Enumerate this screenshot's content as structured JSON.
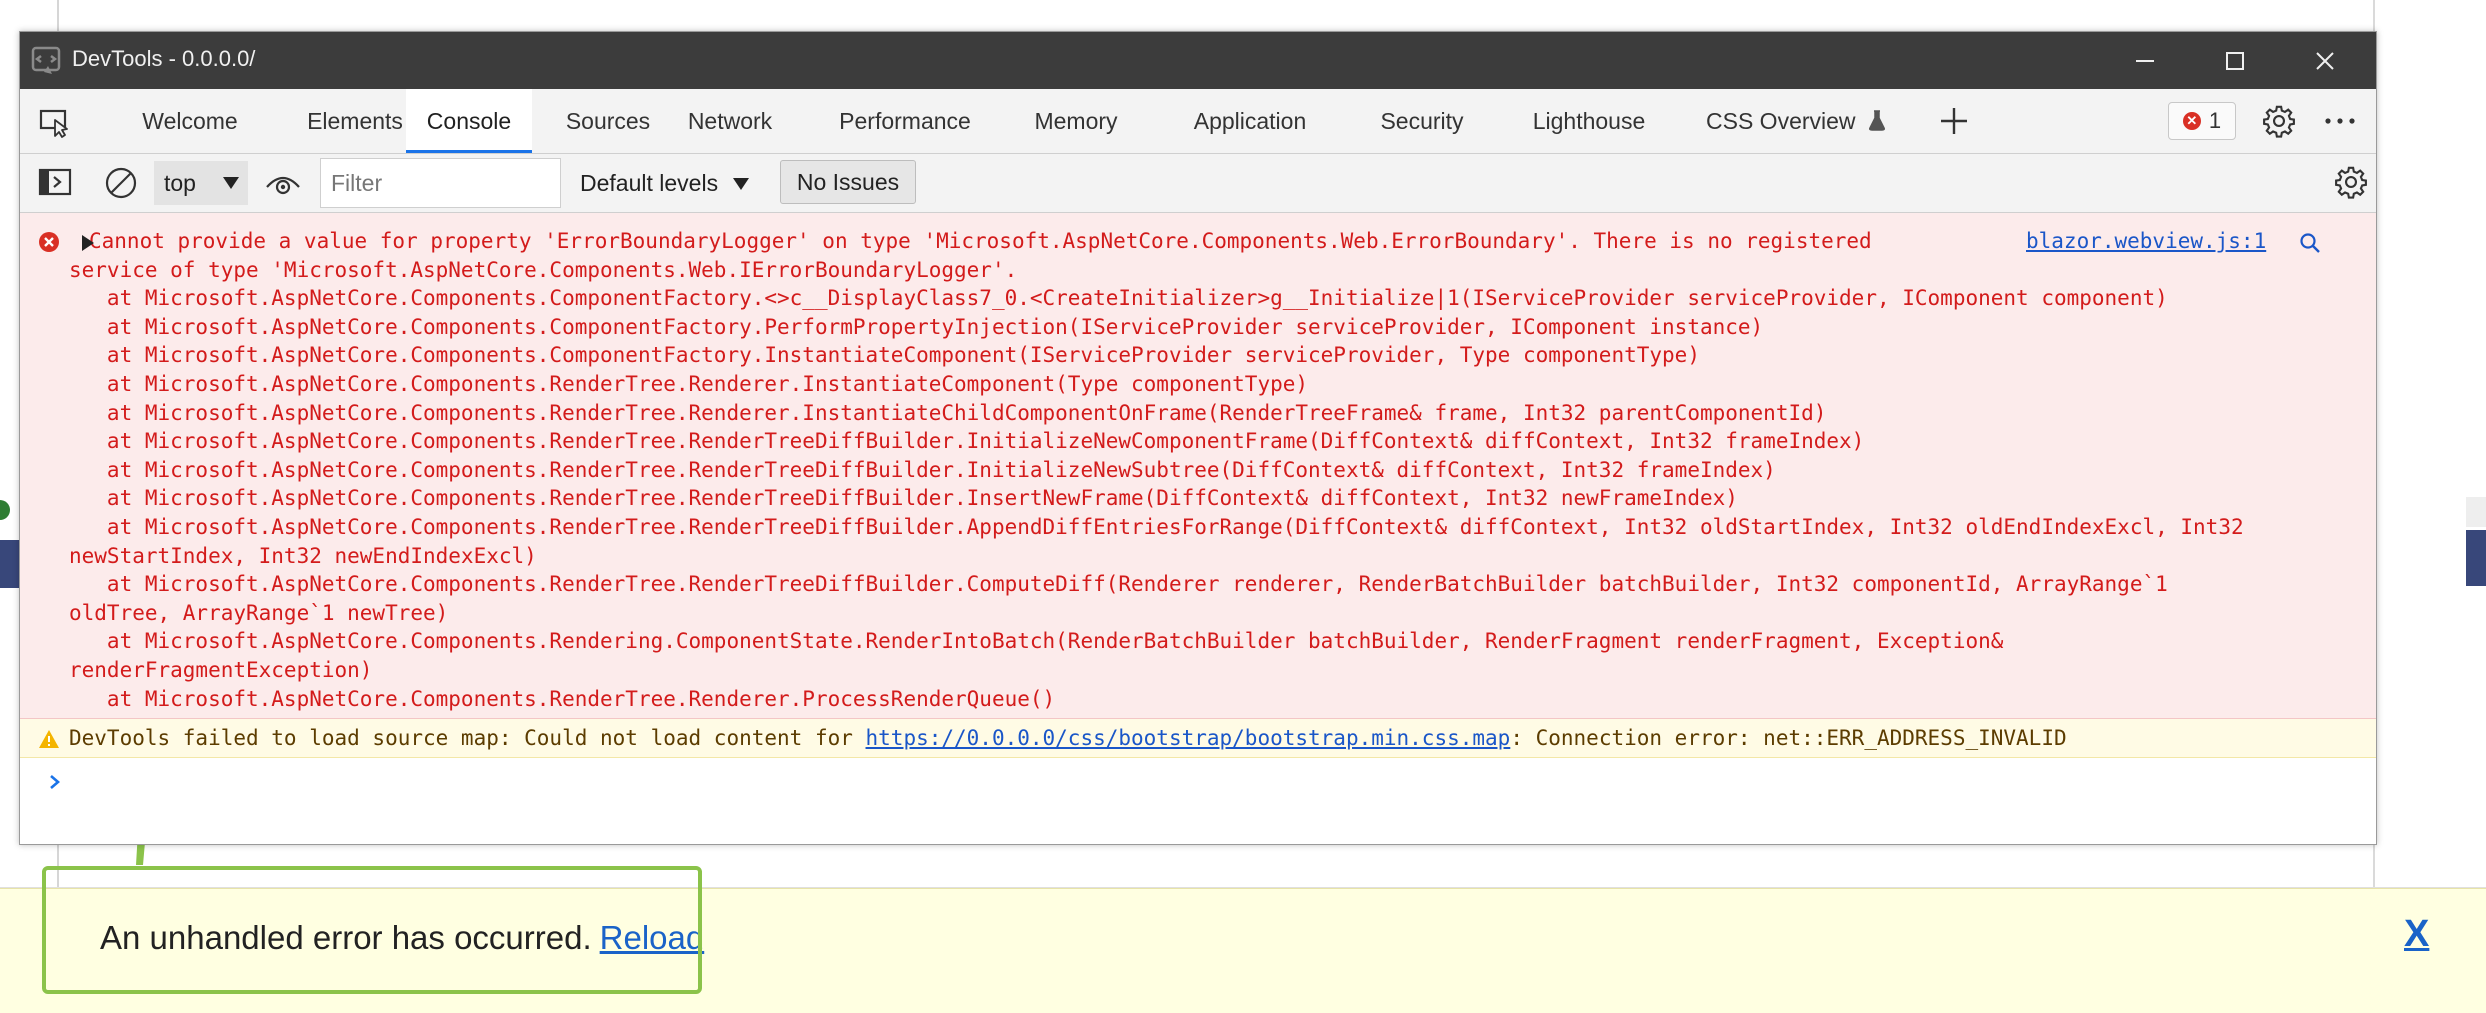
{
  "window": {
    "title": "DevTools - 0.0.0.0/"
  },
  "tabs": [
    {
      "label": "Welcome"
    },
    {
      "label": "Elements"
    },
    {
      "label": "Console",
      "active": true
    },
    {
      "label": "Sources"
    },
    {
      "label": "Network"
    },
    {
      "label": "Performance"
    },
    {
      "label": "Memory"
    },
    {
      "label": "Application"
    },
    {
      "label": "Security"
    },
    {
      "label": "Lighthouse"
    },
    {
      "label": "CSS Overview"
    }
  ],
  "error_count": "1",
  "toolbar": {
    "context": "top",
    "filter_placeholder": "Filter",
    "levels": "Default levels",
    "issues": "No Issues"
  },
  "console": {
    "error_message": "Cannot provide a value for property 'ErrorBoundaryLogger' on type 'Microsoft.AspNetCore.Components.Web.ErrorBoundary'. There is no registered\nservice of type 'Microsoft.AspNetCore.Components.Web.IErrorBoundaryLogger'.\n   at Microsoft.AspNetCore.Components.ComponentFactory.<>c__DisplayClass7_0.<CreateInitializer>g__Initialize|1(IServiceProvider serviceProvider, IComponent component)\n   at Microsoft.AspNetCore.Components.ComponentFactory.PerformPropertyInjection(IServiceProvider serviceProvider, IComponent instance)\n   at Microsoft.AspNetCore.Components.ComponentFactory.InstantiateComponent(IServiceProvider serviceProvider, Type componentType)\n   at Microsoft.AspNetCore.Components.RenderTree.Renderer.InstantiateComponent(Type componentType)\n   at Microsoft.AspNetCore.Components.RenderTree.Renderer.InstantiateChildComponentOnFrame(RenderTreeFrame& frame, Int32 parentComponentId)\n   at Microsoft.AspNetCore.Components.RenderTree.RenderTreeDiffBuilder.InitializeNewComponentFrame(DiffContext& diffContext, Int32 frameIndex)\n   at Microsoft.AspNetCore.Components.RenderTree.RenderTreeDiffBuilder.InitializeNewSubtree(DiffContext& diffContext, Int32 frameIndex)\n   at Microsoft.AspNetCore.Components.RenderTree.RenderTreeDiffBuilder.InsertNewFrame(DiffContext& diffContext, Int32 newFrameIndex)\n   at Microsoft.AspNetCore.Components.RenderTree.RenderTreeDiffBuilder.AppendDiffEntriesForRange(DiffContext& diffContext, Int32 oldStartIndex, Int32 oldEndIndexExcl, Int32\nnewStartIndex, Int32 newEndIndexExcl)\n   at Microsoft.AspNetCore.Components.RenderTree.RenderTreeDiffBuilder.ComputeDiff(Renderer renderer, RenderBatchBuilder batchBuilder, Int32 componentId, ArrayRange`1\noldTree, ArrayRange`1 newTree)\n   at Microsoft.AspNetCore.Components.Rendering.ComponentState.RenderIntoBatch(RenderBatchBuilder batchBuilder, RenderFragment renderFragment, Exception&\nrenderFragmentException)\n   at Microsoft.AspNetCore.Components.RenderTree.Renderer.ProcessRenderQueue()",
    "error_source": "blazor.webview.js:1",
    "warning_prefix": "DevTools failed to load source map: Could not load content for ",
    "warning_link": "https://0.0.0.0/css/bootstrap/bootstrap.min.css.map",
    "warning_suffix": ": Connection error: net::ERR_ADDRESS_INVALID"
  },
  "banner": {
    "message": "An unhandled error has occurred.",
    "reload_label": "Reload",
    "close_label": "X"
  },
  "colors": {
    "error_text": "#d31b1b",
    "error_bg": "#fcebeb",
    "warning_bg": "#fffbe5",
    "banner_bg": "#ffffe1",
    "highlight": "#8bc34a",
    "active_tab": "#1a73e8"
  }
}
